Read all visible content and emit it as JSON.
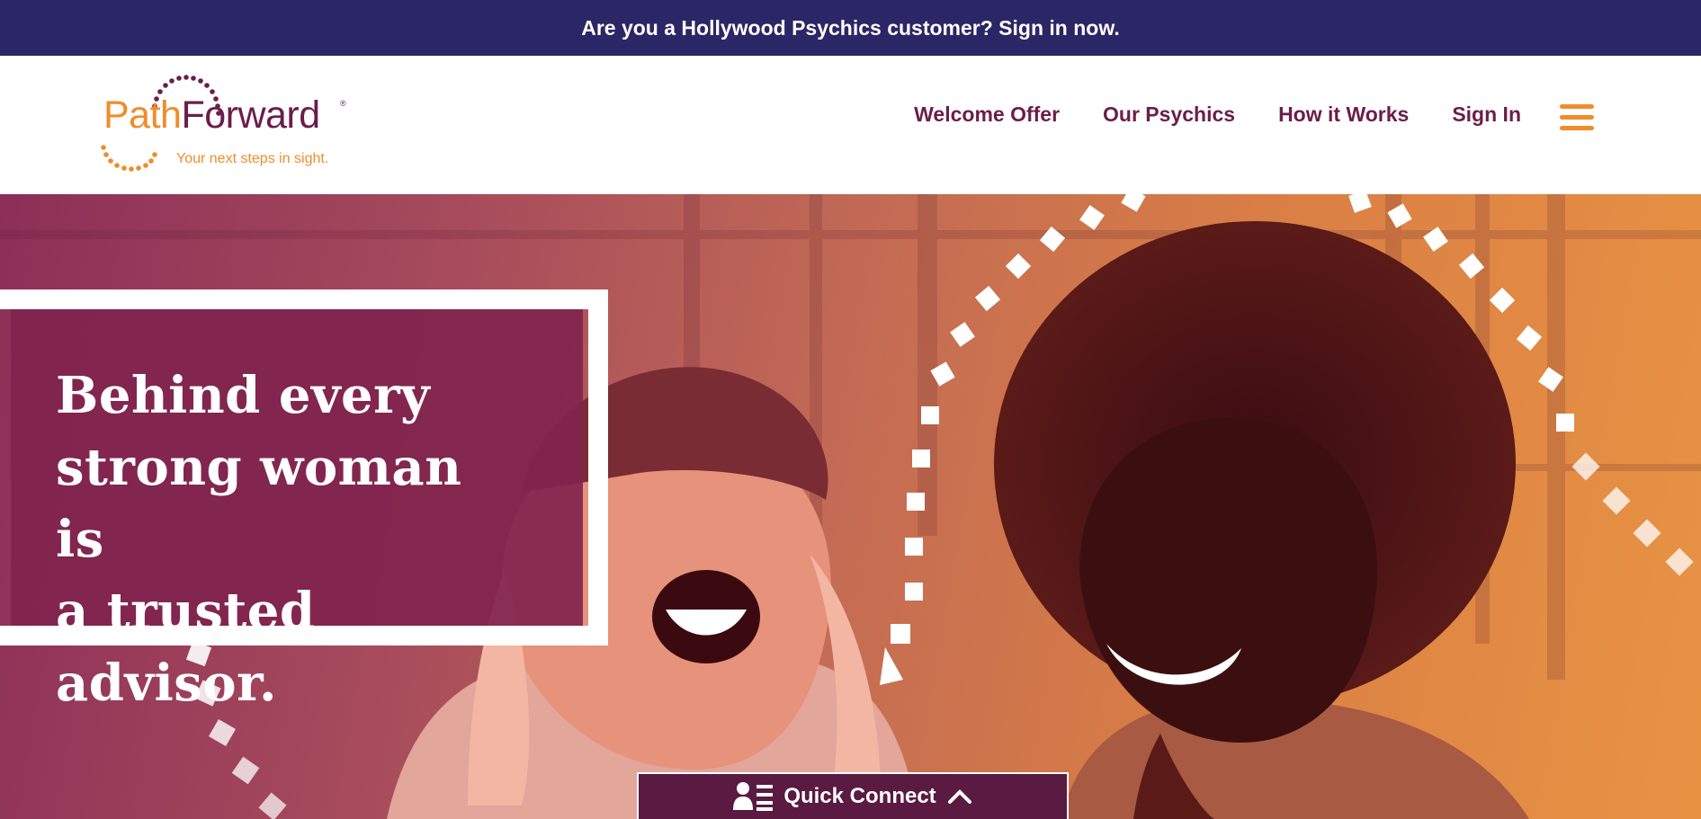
{
  "topbar": {
    "text": "Are you a Hollywood Psychics customer? Sign in now."
  },
  "logo": {
    "word_a": "Path",
    "word_b": "Forward",
    "registered": "®",
    "tagline": "Your next steps in sight."
  },
  "nav": {
    "items": [
      "Welcome Offer",
      "Our Psychics",
      "How it Works",
      "Sign In"
    ]
  },
  "hero": {
    "headline_lines": [
      "Behind every",
      "strong woman is",
      "a trusted advisor."
    ]
  },
  "quick_connect": {
    "label": "Quick Connect"
  },
  "colors": {
    "topbar": "#2b2665",
    "brand_plum": "#6b1d4a",
    "brand_orange": "#ef8d2a",
    "quick_connect_bg": "#5a1a41"
  },
  "icons": [
    "menu-icon",
    "person-list-icon",
    "chevron-up-icon"
  ]
}
